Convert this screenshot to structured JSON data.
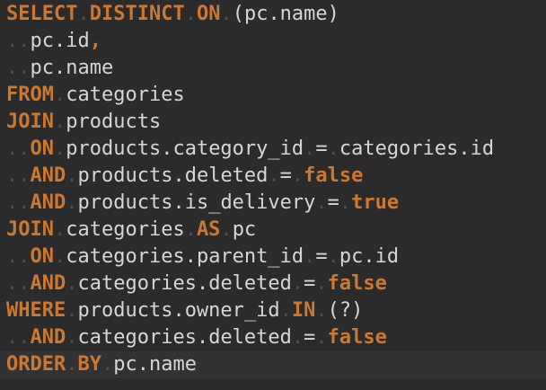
{
  "editor": {
    "lines": [
      [
        {
          "t": "SELECT",
          "k": 1
        },
        {
          "t": " ",
          "w": 1
        },
        {
          "t": "DISTINCT",
          "k": 1
        },
        {
          "t": " ",
          "w": 1
        },
        {
          "t": "ON",
          "k": 1
        },
        {
          "t": " ",
          "w": 1
        },
        {
          "t": "(pc.name)"
        }
      ],
      [
        {
          "t": "  ",
          "w": 1
        },
        {
          "t": "pc.id"
        },
        {
          "t": ",",
          "k": 1
        }
      ],
      [
        {
          "t": "  ",
          "w": 1
        },
        {
          "t": "pc.name"
        }
      ],
      [
        {
          "t": "FROM",
          "k": 1
        },
        {
          "t": " ",
          "w": 1
        },
        {
          "t": "categories"
        }
      ],
      [
        {
          "t": "JOIN",
          "k": 1
        },
        {
          "t": " ",
          "w": 1
        },
        {
          "t": "products"
        }
      ],
      [
        {
          "t": "  ",
          "w": 1
        },
        {
          "t": "ON",
          "k": 1
        },
        {
          "t": " ",
          "w": 1
        },
        {
          "t": "products.category_id"
        },
        {
          "t": " ",
          "w": 1
        },
        {
          "t": "="
        },
        {
          "t": " ",
          "w": 1
        },
        {
          "t": "categories.id"
        }
      ],
      [
        {
          "t": "  ",
          "w": 1
        },
        {
          "t": "AND",
          "k": 1
        },
        {
          "t": " ",
          "w": 1
        },
        {
          "t": "products.deleted"
        },
        {
          "t": " ",
          "w": 1
        },
        {
          "t": "="
        },
        {
          "t": " ",
          "w": 1
        },
        {
          "t": "false",
          "k": 1
        }
      ],
      [
        {
          "t": "  ",
          "w": 1
        },
        {
          "t": "AND",
          "k": 1
        },
        {
          "t": " ",
          "w": 1
        },
        {
          "t": "products.is_delivery"
        },
        {
          "t": " ",
          "w": 1
        },
        {
          "t": "="
        },
        {
          "t": " ",
          "w": 1
        },
        {
          "t": "true",
          "k": 1
        }
      ],
      [
        {
          "t": "JOIN",
          "k": 1
        },
        {
          "t": " ",
          "w": 1
        },
        {
          "t": "categories"
        },
        {
          "t": " ",
          "w": 1
        },
        {
          "t": "AS",
          "k": 1
        },
        {
          "t": " ",
          "w": 1
        },
        {
          "t": "pc"
        }
      ],
      [
        {
          "t": "  ",
          "w": 1
        },
        {
          "t": "ON",
          "k": 1
        },
        {
          "t": " ",
          "w": 1
        },
        {
          "t": "categories.parent_id"
        },
        {
          "t": " ",
          "w": 1
        },
        {
          "t": "="
        },
        {
          "t": " ",
          "w": 1
        },
        {
          "t": "pc.id"
        }
      ],
      [
        {
          "t": "  ",
          "w": 1
        },
        {
          "t": "AND",
          "k": 1
        },
        {
          "t": " ",
          "w": 1
        },
        {
          "t": "categories.deleted"
        },
        {
          "t": " ",
          "w": 1
        },
        {
          "t": "="
        },
        {
          "t": " ",
          "w": 1
        },
        {
          "t": "false",
          "k": 1
        }
      ],
      [
        {
          "t": "WHERE",
          "k": 1
        },
        {
          "t": " ",
          "w": 1
        },
        {
          "t": "products.owner_id"
        },
        {
          "t": " ",
          "w": 1
        },
        {
          "t": "IN",
          "k": 1
        },
        {
          "t": " ",
          "w": 1
        },
        {
          "t": "(?)"
        }
      ],
      [
        {
          "t": "  ",
          "w": 1
        },
        {
          "t": "AND",
          "k": 1
        },
        {
          "t": " ",
          "w": 1
        },
        {
          "t": "categories.deleted"
        },
        {
          "t": " ",
          "w": 1
        },
        {
          "t": "="
        },
        {
          "t": " ",
          "w": 1
        },
        {
          "t": "false",
          "k": 1
        }
      ],
      [
        {
          "t": "ORDER",
          "k": 1
        },
        {
          "t": " ",
          "w": 1
        },
        {
          "t": "BY",
          "k": 1
        },
        {
          "t": " ",
          "w": 1
        },
        {
          "t": "pc.name"
        }
      ]
    ],
    "current_line_index": 13,
    "colors": {
      "background": "#2b2b2b",
      "keyword": "#cc7832",
      "identifier": "#d6d6d6",
      "whitespace_marker": "#4f4f4f",
      "current_line": "#323232"
    }
  }
}
